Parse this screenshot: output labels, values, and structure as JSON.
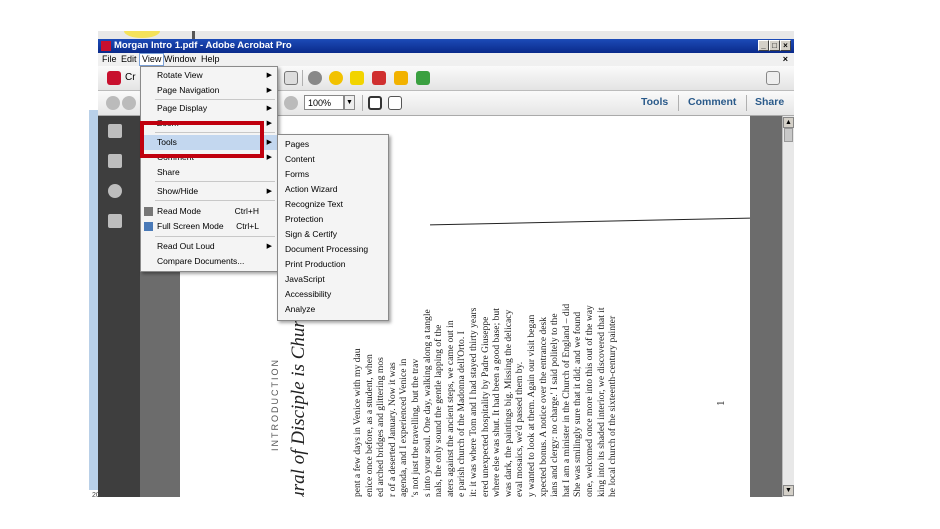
{
  "window": {
    "title": "Morgan Intro  1.pdf - Adobe Acrobat Pro",
    "controls": [
      "_",
      "□",
      "×"
    ]
  },
  "menubar": {
    "items": [
      "File",
      "Edit",
      "View",
      "Window",
      "Help"
    ],
    "close": "×"
  },
  "toolbar": {
    "create_label": "Cr",
    "zoom_value": "100%",
    "tabs": [
      "Tools",
      "Comment",
      "Share"
    ]
  },
  "view_menu": {
    "items": [
      {
        "label": "Rotate View",
        "has_submenu": true
      },
      {
        "label": "Page Navigation",
        "has_submenu": true
      },
      {
        "label": "Page Display",
        "has_submenu": true
      },
      {
        "label": "Zoom",
        "has_submenu": true
      },
      {
        "label": "Tools",
        "has_submenu": true,
        "highlighted": true
      },
      {
        "label": "Comment",
        "has_submenu": true
      },
      {
        "label": "Share"
      },
      {
        "label": "Show/Hide",
        "has_submenu": true
      },
      {
        "label": "Read Mode",
        "shortcut": "Ctrl+H"
      },
      {
        "label": "Full Screen Mode",
        "shortcut": "Ctrl+L"
      },
      {
        "label": "Read Out Loud",
        "has_submenu": true
      },
      {
        "label": "Compare Documents..."
      }
    ]
  },
  "tools_submenu": {
    "items": [
      "Pages",
      "Content",
      "Forms",
      "Action Wizard",
      "Recognize Text",
      "Protection",
      "Sign & Certify",
      "Document Processing",
      "Print Production",
      "JavaScript",
      "Accessibility",
      "Analyze"
    ]
  },
  "document": {
    "chapter_label": "INTRODUCTION",
    "chapter_title": "lural of Disciple is Church",
    "page_number": "1",
    "columns": [
      "pent a few days in Venice with my dau",
      "enice once before, as a student, when",
      "ed arched bridges and glittering mos",
      "r of a deserted January. Now it was",
      "agenda, and I experienced Venice in",
      "'s not just the travelling, but the trav",
      "s into your soul. One day, walking along a tangle",
      "nals, the only sound the gentle lapping of the",
      "aters against the ancient steps, we came out in",
      "e parish church of the Madonna dell'Orto. I",
      "it: it was where Tom and I had stayed thirty years",
      "ered unexpected hospitality by Padre Giuseppe",
      "where else was shut. It had been a good base; but",
      "was dark, the paintings big. Missing the delicacy",
      "eval mosaics, we'd passed them by.",
      "y wanted to look at them. Again our visit began",
      "xpected bonus. A notice over the entrance desk",
      "ians and clergy: no charge.' I said politely to the",
      "hat I am a minister in the Church of England – did",
      "She was smilingly sure that it did; and we found",
      "one, welcomed once more into this out of the way",
      "king into its shaded interior, we discovered that it",
      "he local church of the sixteenth-century painter"
    ]
  },
  "status": {
    "taskbar_snip": "20..."
  }
}
